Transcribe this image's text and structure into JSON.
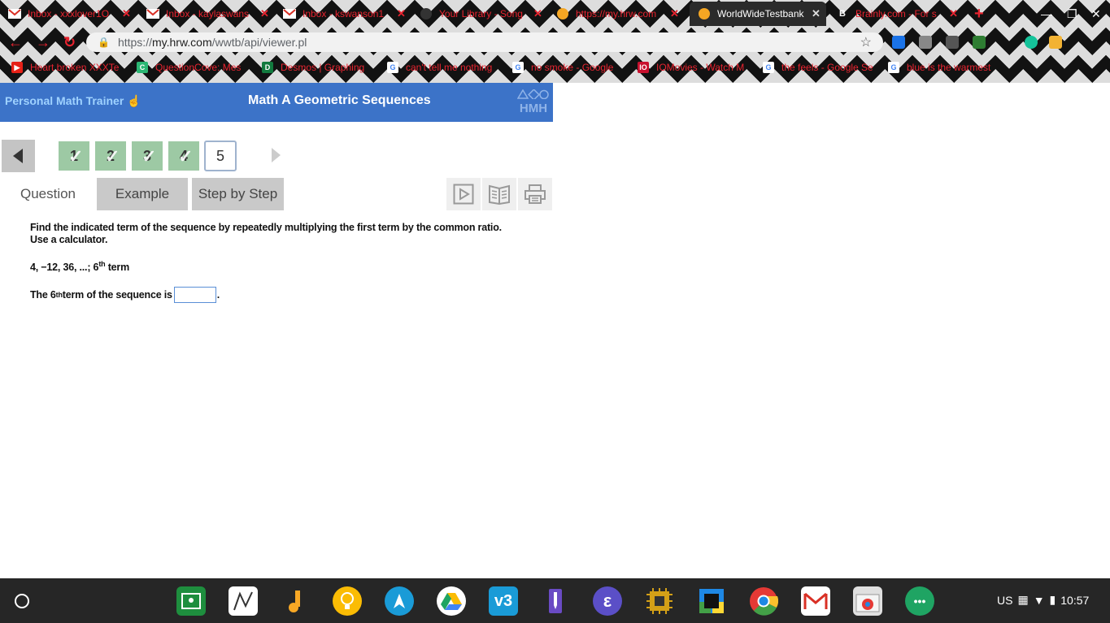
{
  "browser": {
    "tabs": [
      {
        "title": "Inbox - xxxlover1O",
        "favicon": "gmail-icon",
        "active": false
      },
      {
        "title": "Inbox - kaylaswans",
        "favicon": "gmail-icon",
        "active": false
      },
      {
        "title": "Inbox - kswanson1",
        "favicon": "gmail-icon",
        "active": false
      },
      {
        "title": "Your Library - Song",
        "favicon": "spotify-icon",
        "active": false
      },
      {
        "title": "https://my.hrw.com",
        "favicon": "orange-circle-icon",
        "active": false
      },
      {
        "title": "WorldWideTestbank",
        "favicon": "orange-circle-icon",
        "active": true
      },
      {
        "title": "Brainly.com - For s",
        "favicon": "brainly-icon",
        "active": false
      }
    ],
    "url_scheme": "https://",
    "url_host": "my.hrw.com",
    "url_path": "/wwtb/api/viewer.pl",
    "bookmarks": [
      {
        "label": "Heart broken XXXTe",
        "icon": "youtube-icon",
        "color": "#e62117"
      },
      {
        "label": "QuestionCove: Mes",
        "icon": "questioncove-icon",
        "color": "#2bb673"
      },
      {
        "label": "Desmos | Graphing",
        "icon": "desmos-icon",
        "color": "#127a3e"
      },
      {
        "label": "can't tell me nothing",
        "icon": "google-icon",
        "color": "#ffffff"
      },
      {
        "label": "no smoke - Google",
        "icon": "google-icon",
        "color": "#ffffff"
      },
      {
        "label": "IOMovies - Watch M",
        "icon": "iomovies-icon",
        "color": "#c8102e"
      },
      {
        "label": "the feels - Google Se",
        "icon": "google-icon",
        "color": "#ffffff"
      },
      {
        "label": "blue is the warmest",
        "icon": "google-icon",
        "color": "#ffffff"
      }
    ]
  },
  "header": {
    "brand": "Personal Math Trainer",
    "title": "Math A Geometric Sequences",
    "logo_text": "HMH"
  },
  "question_nav": {
    "items": [
      {
        "num": "1",
        "completed": true
      },
      {
        "num": "2",
        "completed": true
      },
      {
        "num": "3",
        "completed": true
      },
      {
        "num": "4",
        "completed": true
      },
      {
        "num": "5",
        "completed": false
      }
    ],
    "current": "5"
  },
  "tabs": {
    "question": "Question",
    "example": "Example",
    "step": "Step by Step"
  },
  "question": {
    "instruction_line1": "Find the indicated term of the sequence by repeatedly multiplying the first term by the common ratio.",
    "instruction_line2": "Use a calculator.",
    "sequence": "4, −12, 36, ...; 6",
    "sequence_sup": "th",
    "sequence_suffix": " term",
    "answer_prefix": "The 6",
    "answer_sup": "th",
    "answer_text": " term of the sequence is",
    "answer_value": "",
    "answer_end": "."
  },
  "shelf": {
    "apps": [
      {
        "name": "google-classroom-icon",
        "color": "#1e8e3e"
      },
      {
        "name": "desmos-app-icon",
        "color": "#ffffff"
      },
      {
        "name": "music-note-icon",
        "color": "#f9a825"
      },
      {
        "name": "keep-icon",
        "color": "#fbbc04"
      },
      {
        "name": "vectr-icon",
        "color": "#1a9bd7"
      },
      {
        "name": "google-drive-icon",
        "color": "#ffffff"
      },
      {
        "name": "v3-icon",
        "color": "#1a9bd7"
      },
      {
        "name": "purple-pen-icon",
        "color": "#6a4bc4"
      },
      {
        "name": "epiphany-icon",
        "color": "#5b4fc7"
      },
      {
        "name": "chip-icon",
        "color": "#d4a017"
      },
      {
        "name": "colorful-square-icon",
        "color": "#1e88e5"
      },
      {
        "name": "chrome-icon",
        "color": "#e53935"
      },
      {
        "name": "gmail-app-icon",
        "color": "#ffffff"
      },
      {
        "name": "chrome-webstore-icon",
        "color": "#e0e0e0"
      },
      {
        "name": "hangouts-icon",
        "color": "#1fa463"
      }
    ],
    "locale": "US",
    "time": "10:57"
  }
}
